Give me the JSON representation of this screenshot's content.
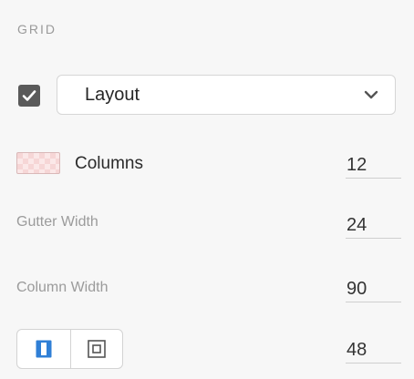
{
  "section": {
    "title": "GRID"
  },
  "layout": {
    "enabled": true,
    "dropdown_value": "Layout"
  },
  "columns": {
    "label": "Columns",
    "value": "12"
  },
  "gutter_width": {
    "label": "Gutter Width",
    "value": "24"
  },
  "column_width": {
    "label": "Column Width",
    "value": "90"
  },
  "offset": {
    "value": "48",
    "modes": [
      {
        "name": "stretch-columns-icon",
        "active": true
      },
      {
        "name": "center-box-icon",
        "active": false
      }
    ]
  },
  "colors": {
    "accent": "#2f7fd6",
    "checkbox": "#5a5a5a",
    "swatch": "#f6d6d6"
  }
}
